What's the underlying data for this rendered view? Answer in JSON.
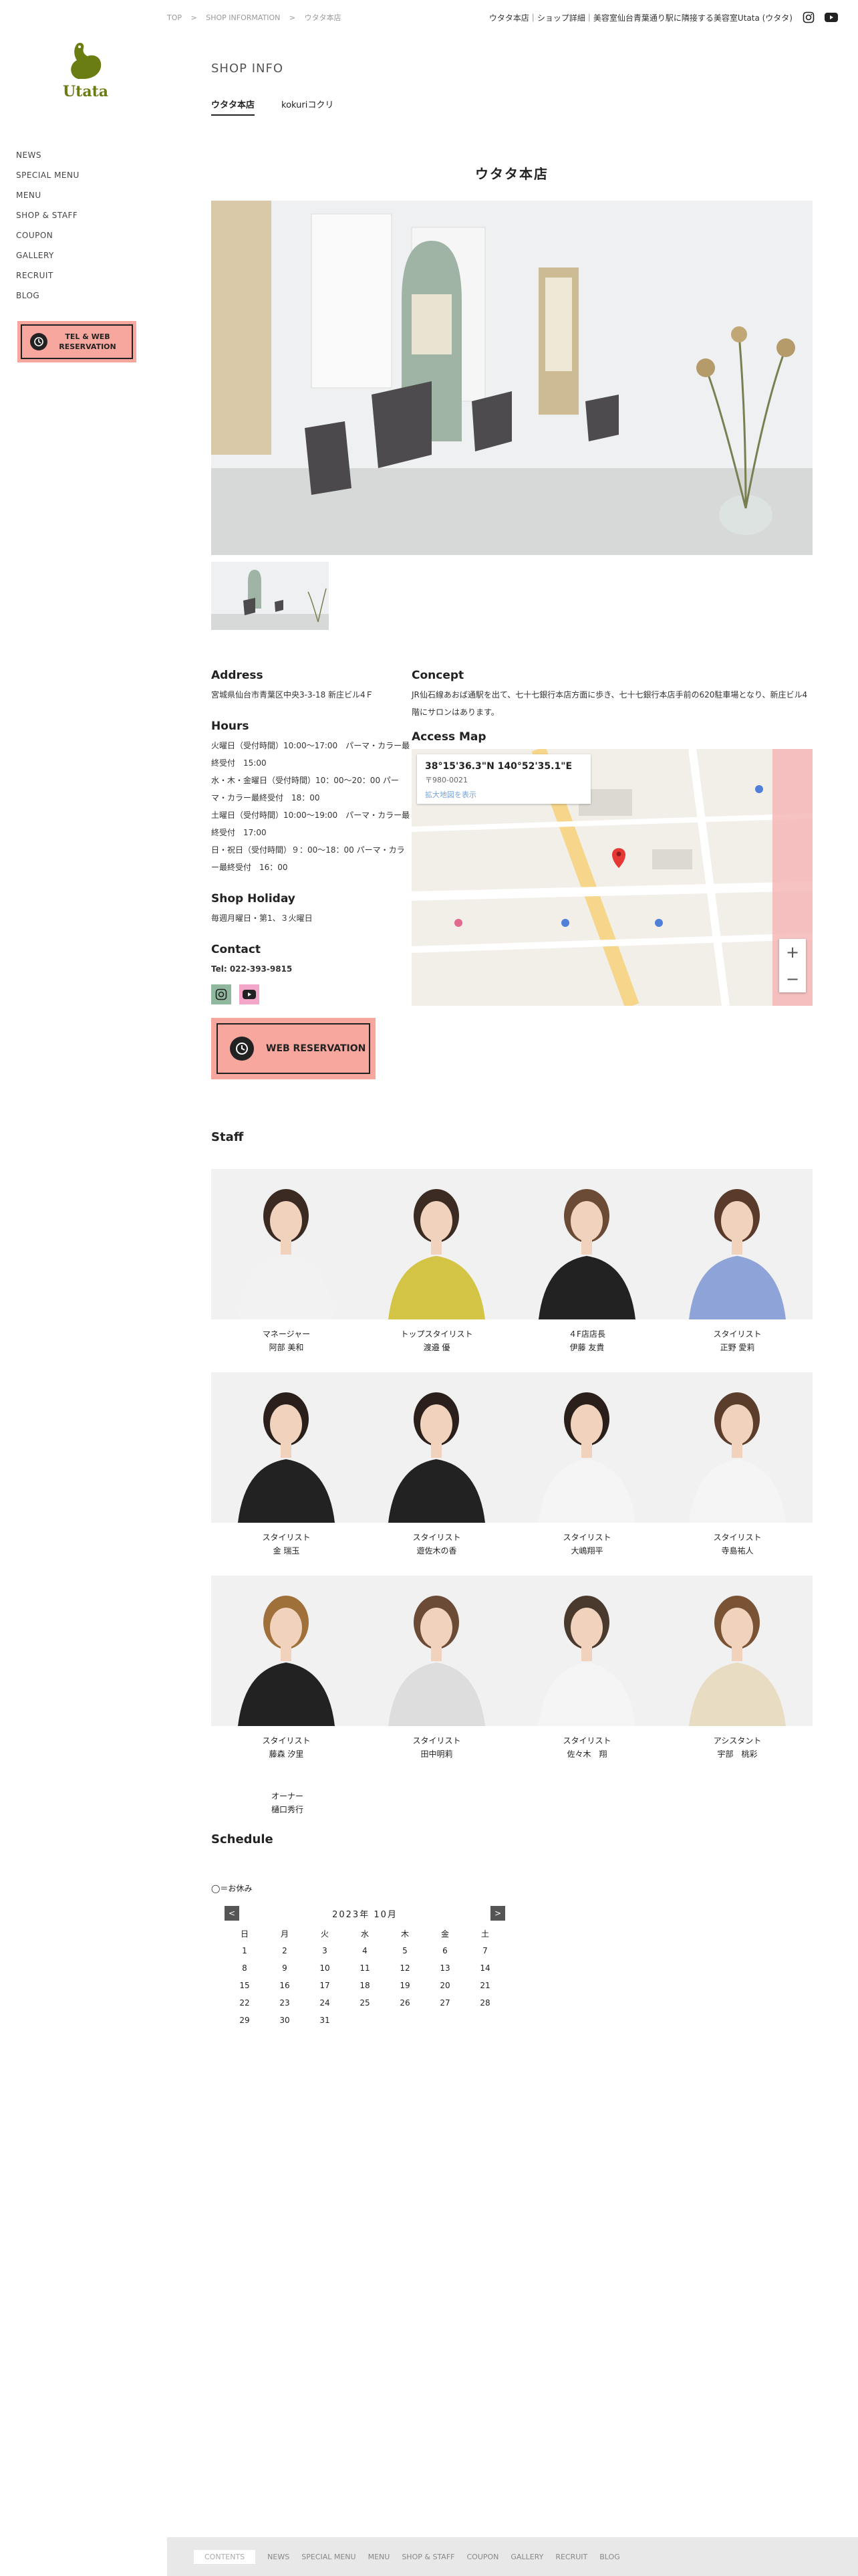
{
  "breadcrumb": [
    "TOP",
    ">",
    "SHOP INFORMATION",
    ">",
    "ウタタ本店"
  ],
  "header": {
    "tagline": "ウタタ本店｜ショップ詳細｜美容室仙台青葉通り駅に隣接する美容室Utata (ウタタ)",
    "instagram_icon": "instagram-icon",
    "youtube_icon": "youtube-icon"
  },
  "logo": {
    "word": "Utata",
    "color": "#6a7d12"
  },
  "sidebar": {
    "items": [
      {
        "label": "NEWS"
      },
      {
        "label": "SPECIAL MENU"
      },
      {
        "label": "MENU"
      },
      {
        "label": "SHOP & STAFF"
      },
      {
        "label": "COUPON"
      },
      {
        "label": "GALLERY"
      },
      {
        "label": "RECRUIT"
      },
      {
        "label": "BLOG"
      }
    ],
    "tel_button": "TEL & WEB RESERVATION"
  },
  "page": {
    "title": "SHOP INFO",
    "tabs": [
      {
        "label": "ウタタ本店",
        "active": true
      },
      {
        "label": "kokuriコクリ",
        "active": false
      }
    ],
    "shop_name": "ウタタ本店"
  },
  "info": {
    "address_h": "Address",
    "address": "宮城県仙台市青葉区中央3-3-18 新庄ビル4Ｆ",
    "hours_h": "Hours",
    "hours": [
      "火曜日（受付時間）10:00〜17:00　パーマ・カラー最終受付　15:00",
      "水・木・金曜日（受付時間）10：00〜20：00 パーマ・カラー最終受付　18：00",
      "土曜日（受付時間）10:00〜19:00　パーマ・カラー最終受付　17:00",
      "日・祝日（受付時間）９：00〜18：00 パーマ・カラー最終受付　16：00"
    ],
    "holiday_h": "Shop Holiday",
    "holiday": "毎週月曜日・第1、３火曜日",
    "contact_h": "Contact",
    "tel": "Tel: 022-393-9815",
    "web_button": "WEB RESERVATION",
    "concept_h": "Concept",
    "concept": "JR仙石線あおば通駅を出て、七十七銀行本店方面に歩き、七十七銀行本店手前の620駐車場となり、新庄ビル4階にサロンはあります。",
    "map_h": "Access Map",
    "map_coord": "38°15'36.3\"N 140°52'35.1\"E",
    "map_postal": "〒980-0021",
    "map_link": "拡大地図を表示",
    "map_plus": "+",
    "map_minus": "−"
  },
  "staff_h": "Staff",
  "staff": [
    {
      "role": "マネージャー",
      "name": "阿部 美和"
    },
    {
      "role": "トップスタイリスト",
      "name": "渡邉 優"
    },
    {
      "role": "４F店店長",
      "name": "伊藤 友貴"
    },
    {
      "role": "スタイリスト",
      "name": "正野 愛莉"
    },
    {
      "role": "スタイリスト",
      "name": "金 瑞玉"
    },
    {
      "role": "スタイリスト",
      "name": "遊佐木の香"
    },
    {
      "role": "スタイリスト",
      "name": "大嶋翔平"
    },
    {
      "role": "スタイリスト",
      "name": "寺島祐人"
    },
    {
      "role": "スタイリスト",
      "name": "藤森 汐里"
    },
    {
      "role": "スタイリスト",
      "name": "田中明莉"
    },
    {
      "role": "スタイリスト",
      "name": "佐々木　翔"
    },
    {
      "role": "アシスタント",
      "name": "宇部　桃彩"
    }
  ],
  "owner": {
    "role": "オーナー",
    "name": "樋口秀行"
  },
  "schedule": {
    "title": "Schedule",
    "legend": "◯＝お休み",
    "prev": "<",
    "next": ">",
    "month": "2023年 10月",
    "weekdays": [
      "日",
      "月",
      "火",
      "水",
      "木",
      "金",
      "土"
    ],
    "weeks": [
      [
        "1",
        "2",
        "3",
        "4",
        "5",
        "6",
        "7"
      ],
      [
        "8",
        "9",
        "10",
        "11",
        "12",
        "13",
        "14"
      ],
      [
        "15",
        "16",
        "17",
        "18",
        "19",
        "20",
        "21"
      ],
      [
        "22",
        "23",
        "24",
        "25",
        "26",
        "27",
        "28"
      ],
      [
        "29",
        "30",
        "31",
        "",
        "",
        "",
        ""
      ]
    ]
  },
  "footer": {
    "contents": "CONTENTS",
    "items": [
      "NEWS",
      "SPECIAL MENU",
      "MENU",
      "SHOP & STAFF",
      "COUPON",
      "GALLERY",
      "RECRUIT",
      "BLOG"
    ]
  }
}
